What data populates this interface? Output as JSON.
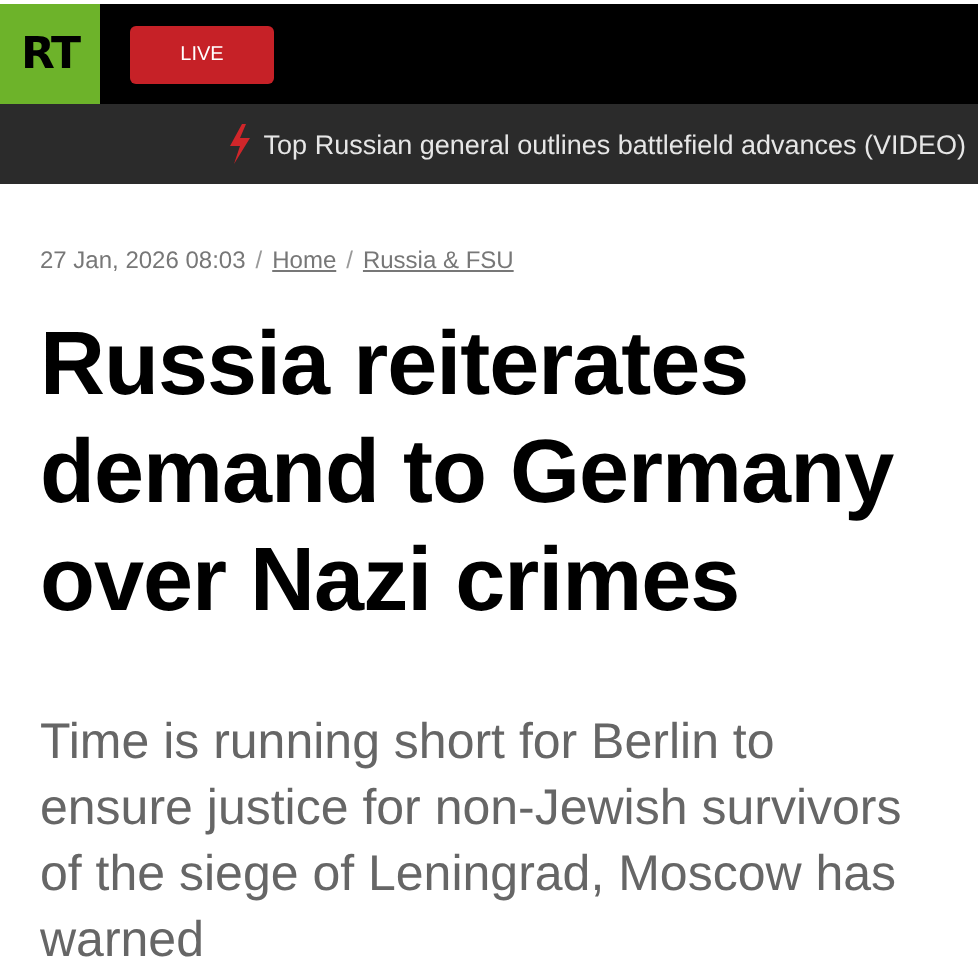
{
  "header": {
    "logo": "RT",
    "live_button": "LIVE"
  },
  "ticker": {
    "headline": "Top Russian general outlines battlefield advances (VIDEO)"
  },
  "article": {
    "timestamp": "27 Jan, 2026 08:03",
    "breadcrumbs": [
      {
        "separator": "/",
        "label": "Home"
      },
      {
        "separator": "/",
        "label": "Russia & FSU"
      }
    ],
    "title": "Russia reiterates demand to Germany over Nazi crimes",
    "summary": "Time is running short for Berlin to ensure justice for non-Jewish survivors of the siege of Leningrad, Moscow has warned"
  }
}
